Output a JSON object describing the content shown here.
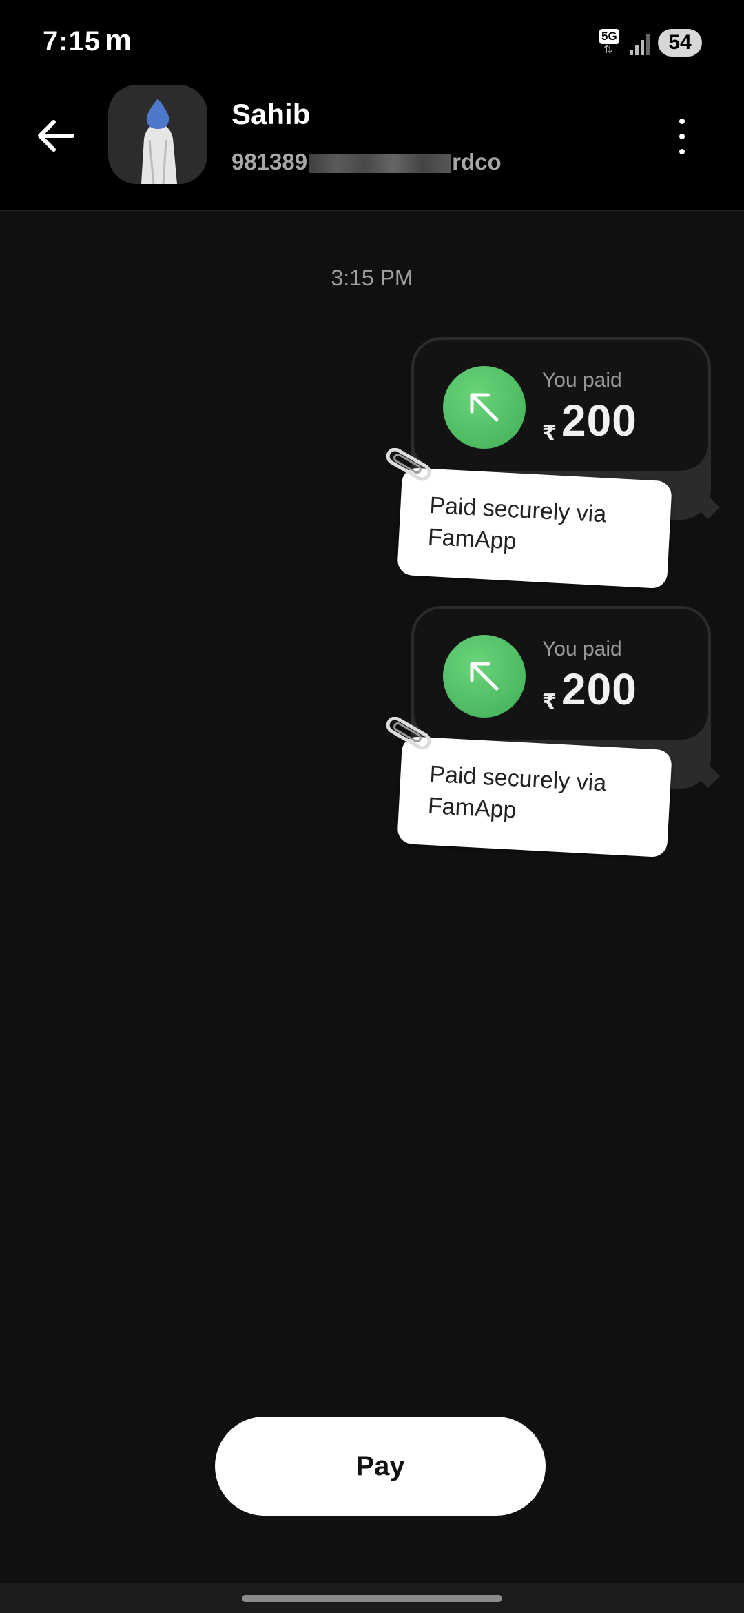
{
  "status_bar": {
    "time": "7:15",
    "carrier_glyph": "m",
    "network": "5G",
    "battery": "54"
  },
  "header": {
    "contact_name": "Sahib",
    "contact_id_prefix": "981389",
    "contact_id_suffix": "rdco"
  },
  "chat": {
    "timestamp": "3:15 PM",
    "messages": [
      {
        "label": "You paid",
        "currency": "₹",
        "amount": "200",
        "note": "Paid securely via FamApp"
      },
      {
        "label": "You paid",
        "currency": "₹",
        "amount": "200",
        "note": "Paid securely via FamApp"
      }
    ]
  },
  "footer": {
    "pay_label": "Pay"
  },
  "colors": {
    "background": "#101010",
    "header_bg": "#000000",
    "accent_green": "#4cbc5e",
    "note_bg": "#ffffff"
  },
  "icons": [
    "back-arrow-icon",
    "more-vertical-icon",
    "arrow-up-left-icon",
    "paperclip-icon",
    "signal-icon",
    "battery-icon"
  ]
}
